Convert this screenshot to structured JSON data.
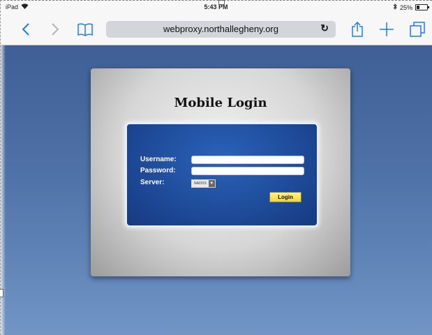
{
  "status": {
    "device": "iPad",
    "time": "5:43 PM",
    "battery": "25%"
  },
  "browser": {
    "url": "webproxy.northallegheny.org"
  },
  "login": {
    "title": "Mobile Login",
    "username_label": "Username:",
    "username_value": "",
    "password_label": "Password:",
    "password_value": "",
    "server_label": "Server:",
    "server_value": "NADOS",
    "login_button": "Login"
  },
  "colors": {
    "accent": "#1a7cf4",
    "page_bg": "#4f72a8",
    "form_bg": "#1e4a98",
    "button": "#f1d33a"
  },
  "icons": [
    "wifi-icon",
    "bluetooth-icon",
    "battery-icon",
    "back-icon",
    "forward-icon",
    "bookmarks-icon",
    "reload-icon",
    "share-icon",
    "new-tab-icon",
    "tabs-icon",
    "dropdown-arrow-icon"
  ]
}
